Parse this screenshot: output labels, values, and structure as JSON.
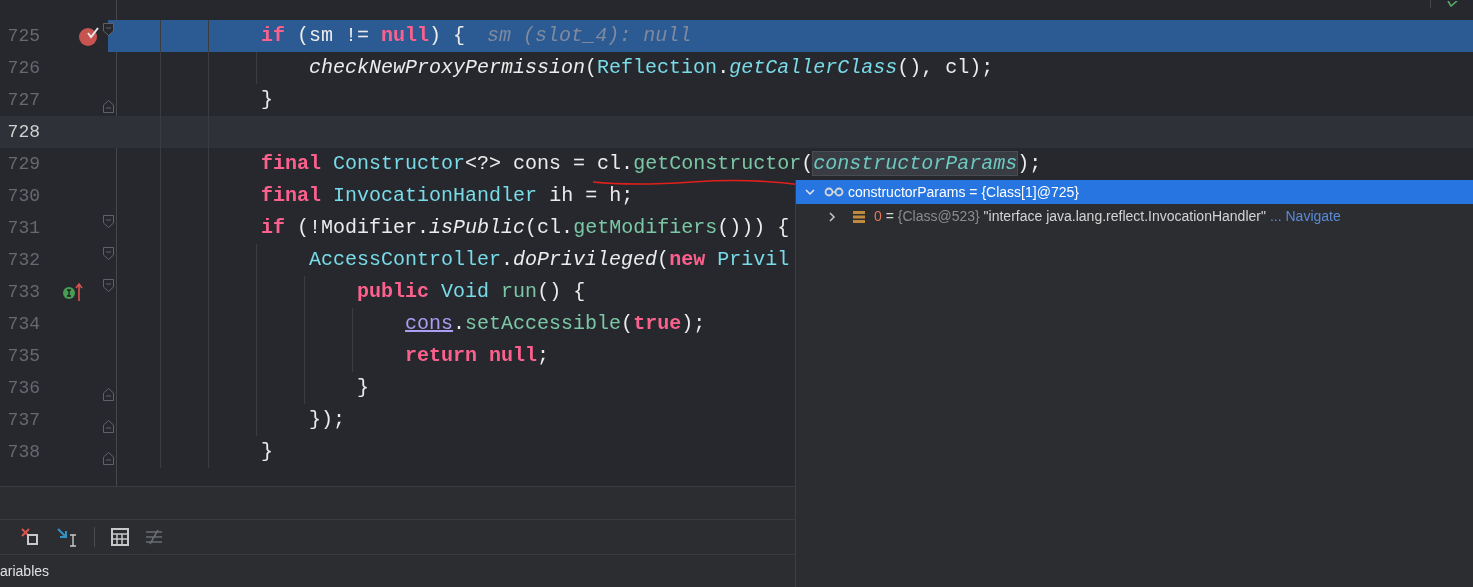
{
  "editor": {
    "lines": [
      {
        "number": "725",
        "execution_point": true,
        "caret_line": false,
        "fold_start": true,
        "fold_end": false,
        "breakpoint": true,
        "implements_marker": false,
        "hint": "sm (slot_4): null",
        "tokens": [
          {
            "text": "            if",
            "kind": "kw"
          },
          {
            "text": " (sm != ",
            "kind": "plain"
          },
          {
            "text": "null",
            "kind": "kw"
          },
          {
            "text": ") {",
            "kind": "plain"
          }
        ]
      },
      {
        "number": "726",
        "execution_point": false,
        "caret_line": false,
        "fold_start": false,
        "fold_end": false,
        "breakpoint": false,
        "implements_marker": false,
        "tokens": [
          {
            "text": "                checkNewProxyPermission",
            "kind": "italic"
          },
          {
            "text": "(",
            "kind": "plain"
          },
          {
            "text": "Reflection",
            "kind": "type"
          },
          {
            "text": ".",
            "kind": "plain"
          },
          {
            "text": "getCallerClass",
            "kind": "italic-type"
          },
          {
            "text": "(), cl);",
            "kind": "plain"
          }
        ]
      },
      {
        "number": "727",
        "execution_point": false,
        "caret_line": false,
        "fold_start": false,
        "fold_end": true,
        "breakpoint": false,
        "implements_marker": false,
        "tokens": [
          {
            "text": "            }",
            "kind": "plain"
          }
        ]
      },
      {
        "number": "728",
        "execution_point": false,
        "caret_line": true,
        "fold_start": false,
        "fold_end": false,
        "breakpoint": false,
        "implements_marker": false
      },
      {
        "number": "729",
        "execution_point": false,
        "caret_line": false,
        "fold_start": false,
        "fold_end": false,
        "breakpoint": false,
        "implements_marker": false,
        "tokens": [
          {
            "text": "            final",
            "kind": "kw"
          },
          {
            "text": " Constructor",
            "kind": "type"
          },
          {
            "text": "<?> cons = cl.",
            "kind": "plain"
          },
          {
            "text": "getConstructor",
            "kind": "method"
          },
          {
            "text": "(",
            "kind": "plain"
          },
          {
            "text": "constructorParams",
            "kind": "param"
          },
          {
            "text": ");",
            "kind": "plain"
          }
        ]
      },
      {
        "number": "730",
        "execution_point": false,
        "caret_line": false,
        "fold_start": false,
        "fold_end": false,
        "breakpoint": false,
        "implements_marker": false,
        "tokens": [
          {
            "text": "            final",
            "kind": "kw"
          },
          {
            "text": " InvocationHandler",
            "kind": "type"
          },
          {
            "text": " ih = h;",
            "kind": "plain"
          }
        ]
      },
      {
        "number": "731",
        "execution_point": false,
        "caret_line": false,
        "fold_start": true,
        "fold_end": false,
        "breakpoint": false,
        "implements_marker": false,
        "tokens": [
          {
            "text": "            if",
            "kind": "kw"
          },
          {
            "text": " (!Modifier.",
            "kind": "plain"
          },
          {
            "text": "isPublic",
            "kind": "italic"
          },
          {
            "text": "(cl.",
            "kind": "plain"
          },
          {
            "text": "getModifiers",
            "kind": "method"
          },
          {
            "text": "())) {",
            "kind": "plain"
          }
        ]
      },
      {
        "number": "732",
        "execution_point": false,
        "caret_line": false,
        "fold_start": true,
        "fold_end": false,
        "breakpoint": false,
        "implements_marker": false,
        "tokens": [
          {
            "text": "                AccessController",
            "kind": "type"
          },
          {
            "text": ".",
            "kind": "plain"
          },
          {
            "text": "doPrivileged",
            "kind": "italic"
          },
          {
            "text": "(",
            "kind": "plain"
          },
          {
            "text": "new",
            "kind": "kw"
          },
          {
            "text": " Privil",
            "kind": "type"
          }
        ]
      },
      {
        "number": "733",
        "execution_point": false,
        "caret_line": false,
        "fold_start": true,
        "fold_end": false,
        "breakpoint": false,
        "implements_marker": true,
        "tokens": [
          {
            "text": "                    public",
            "kind": "kw"
          },
          {
            "text": " Void",
            "kind": "type"
          },
          {
            "text": " run",
            "kind": "method"
          },
          {
            "text": "() {",
            "kind": "plain"
          }
        ]
      },
      {
        "number": "734",
        "execution_point": false,
        "caret_line": false,
        "fold_start": false,
        "fold_end": false,
        "breakpoint": false,
        "implements_marker": false,
        "tokens": [
          {
            "text": "                        cons",
            "kind": "field"
          },
          {
            "text": ".",
            "kind": "plain"
          },
          {
            "text": "setAccessible",
            "kind": "method"
          },
          {
            "text": "(",
            "kind": "plain"
          },
          {
            "text": "true",
            "kind": "kw"
          },
          {
            "text": ");",
            "kind": "plain"
          }
        ]
      },
      {
        "number": "735",
        "execution_point": false,
        "caret_line": false,
        "fold_start": false,
        "fold_end": false,
        "breakpoint": false,
        "implements_marker": false,
        "tokens": [
          {
            "text": "                        return",
            "kind": "kw"
          },
          {
            "text": " null",
            "kind": "kw"
          },
          {
            "text": ";",
            "kind": "plain"
          }
        ]
      },
      {
        "number": "736",
        "execution_point": false,
        "caret_line": false,
        "fold_start": false,
        "fold_end": true,
        "breakpoint": false,
        "implements_marker": false,
        "tokens": [
          {
            "text": "                    }",
            "kind": "plain"
          }
        ]
      },
      {
        "number": "737",
        "execution_point": false,
        "caret_line": false,
        "fold_start": false,
        "fold_end": true,
        "breakpoint": false,
        "implements_marker": false,
        "tokens": [
          {
            "text": "                });",
            "kind": "plain"
          }
        ]
      },
      {
        "number": "738",
        "execution_point": false,
        "caret_line": false,
        "fold_start": false,
        "fold_end": true,
        "breakpoint": false,
        "implements_marker": false,
        "tokens": [
          {
            "text": "            }",
            "kind": "plain"
          }
        ]
      }
    ]
  },
  "debug_panel": {
    "toolbar": [
      {
        "kind": "remove",
        "disabled": false
      },
      {
        "kind": "step-into-cursor",
        "disabled": false
      },
      {
        "kind": "calculator",
        "disabled": false
      },
      {
        "kind": "lines",
        "disabled": true
      }
    ],
    "tab": "ariables"
  },
  "value_popup": {
    "root": {
      "name": "constructorParams",
      "separator": " = ",
      "value": "{Class[1]@725}",
      "expanded": true,
      "selected": true
    },
    "children": [
      {
        "name": "0",
        "separator": " = ",
        "type": "{Class@523}",
        "value": "\"interface java.lang.reflect.InvocationHandler\"",
        "link": "... Navigate",
        "expanded": false,
        "selected": false
      }
    ]
  }
}
